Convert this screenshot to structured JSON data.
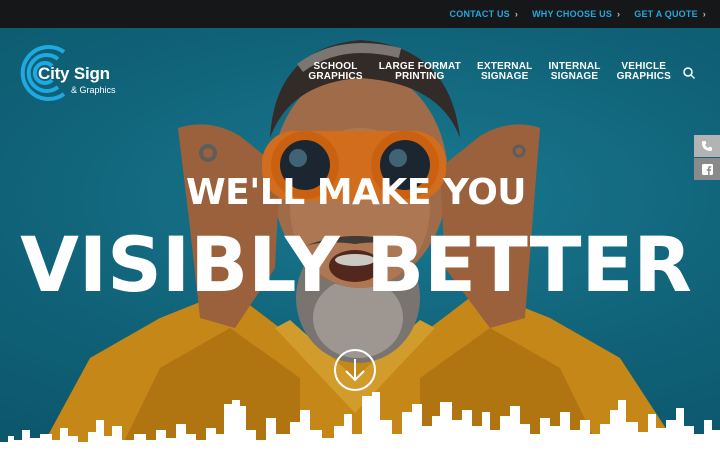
{
  "topbar": {
    "links": [
      {
        "label": "CONTACT US"
      },
      {
        "label": "WHY CHOOSE US"
      },
      {
        "label": "GET A QUOTE"
      }
    ],
    "link_color": "#21a8e0",
    "background": "#161718"
  },
  "logo": {
    "name": "City Sign",
    "sub": "& Graphics",
    "brand_color": "#1fa9e1"
  },
  "nav": {
    "items": [
      {
        "label": "SCHOOL\nGRAPHICS"
      },
      {
        "label": "LARGE FORMAT\nPRINTING"
      },
      {
        "label": "EXTERNAL\nSIGNAGE"
      },
      {
        "label": "INTERNAL\nSIGNAGE"
      },
      {
        "label": "VEHICLE\nGRAPHICS"
      }
    ],
    "search_icon": "search-icon"
  },
  "side_tabs": [
    {
      "icon": "phone-icon"
    },
    {
      "icon": "facebook-icon"
    }
  ],
  "hero": {
    "line1": "WE'LL MAKE YOU",
    "line2": "VISIBLY BETTER",
    "scroll_icon": "arrow-down-circle-icon",
    "jacket_color": "#e09a1c",
    "background_color": "#137089"
  }
}
